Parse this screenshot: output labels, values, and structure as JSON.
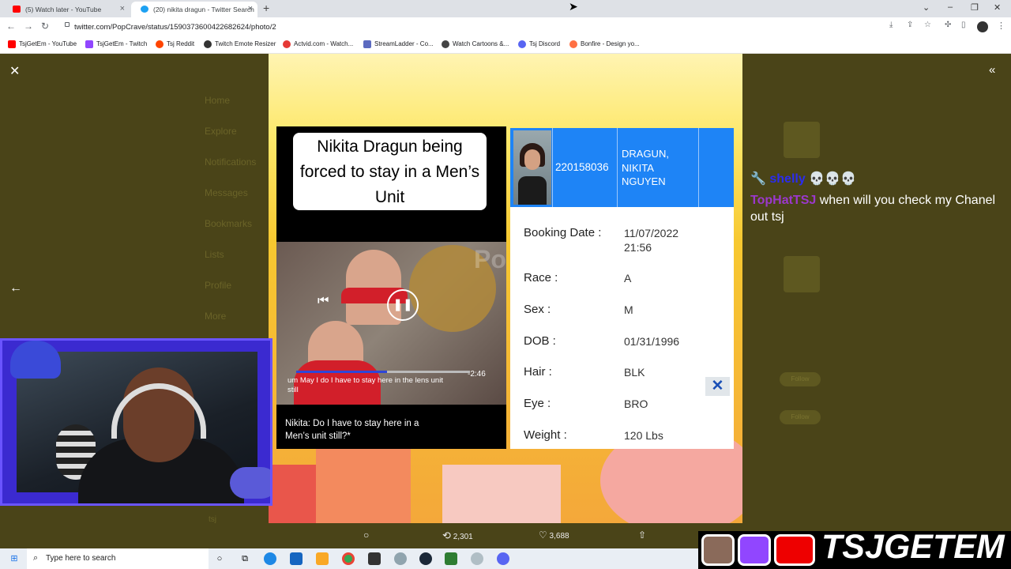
{
  "browser": {
    "tabs": [
      {
        "title": "(5) Watch later - YouTube",
        "fav": "#ff0000"
      },
      {
        "title": "(20) nikita dragun - Twitter Search",
        "fav": "#1da1f2"
      }
    ],
    "new_tab": "+",
    "url": "twitter.com/PopCrave/status/1590373600422682624/photo/2",
    "bookmarks": [
      {
        "label": "TsjGetEm - YouTube",
        "color": "#ff0000"
      },
      {
        "label": "TsjGetEm - Twitch",
        "color": "#9146ff"
      },
      {
        "label": "Tsj Reddit",
        "color": "#ff4500"
      },
      {
        "label": "Twitch Emote Resizer",
        "color": "#333333"
      },
      {
        "label": "Actvid.com - Watch...",
        "color": "#e53935"
      },
      {
        "label": "StreamLadder - Co...",
        "color": "#5c6bc0"
      },
      {
        "label": "Watch Cartoons &...",
        "color": "#444444"
      },
      {
        "label": "Tsj Discord",
        "color": "#5865f2"
      },
      {
        "label": "Bonfire - Design yo...",
        "color": "#ff7043"
      }
    ]
  },
  "twitter": {
    "sidebar": [
      "Home",
      "Explore",
      "Notifications",
      "Messages",
      "Bookmarks",
      "Lists",
      "Profile",
      "More"
    ],
    "right_ghost": [
      "Follow",
      "Follow"
    ],
    "actions": {
      "retweets": "2,301",
      "likes": "3,688"
    },
    "profile": "tsj"
  },
  "video": {
    "title": "Nikita Dragun being forced to stay in a Men’s Unit",
    "sub1": "um May I do I have to stay here in the lens unit still",
    "time": "-2:46",
    "sub2": "Nikita: Do I have to stay here in a Men’s unit still?*",
    "watermark": "Pop"
  },
  "booking": {
    "id": "220158036",
    "name": "DRAGUN, NIKITA NGUYEN",
    "rows": [
      {
        "label": "Booking Date :",
        "value": "11/07/2022 21:56"
      },
      {
        "label": "Race :",
        "value": "A"
      },
      {
        "label": "Sex :",
        "value": "M"
      },
      {
        "label": "DOB :",
        "value": "01/31/1996"
      },
      {
        "label": "Hair :",
        "value": "BLK"
      },
      {
        "label": "Eye :",
        "value": "BRO"
      },
      {
        "label": "Weight :",
        "value": "120 Lbs"
      }
    ],
    "close": "✕"
  },
  "chat": [
    {
      "user": "shelly",
      "msg": "💀💀💀"
    },
    {
      "user": "TopHatTSJ",
      "msg": "when will you check my Chanel out tsj"
    }
  ],
  "taskbar": {
    "search_placeholder": "Type here to search"
  },
  "brand": "TSJGETEM"
}
